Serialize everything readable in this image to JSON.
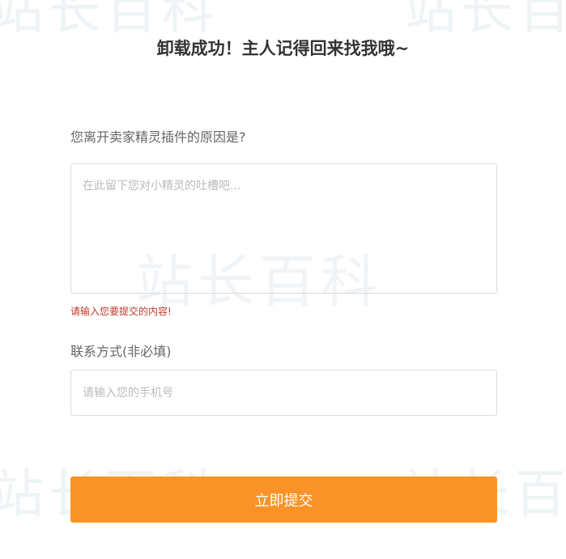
{
  "watermark": {
    "text": "站长百科"
  },
  "header": {
    "title": "卸载成功！主人记得回来找我哦~"
  },
  "form": {
    "reason_label": "您离开卖家精灵插件的原因是?",
    "reason_placeholder": "在此留下您对小精灵的吐槽吧...",
    "reason_value": "",
    "reason_error": "请输入您要提交的内容!",
    "contact_label": "联系方式(非必填)",
    "contact_placeholder": "请输入您的手机号",
    "contact_value": "",
    "submit_label": "立即提交"
  },
  "colors": {
    "accent": "#fa9327",
    "error": "#c0392b",
    "border": "#dcdcdc",
    "title": "#333333",
    "label": "#666666"
  }
}
